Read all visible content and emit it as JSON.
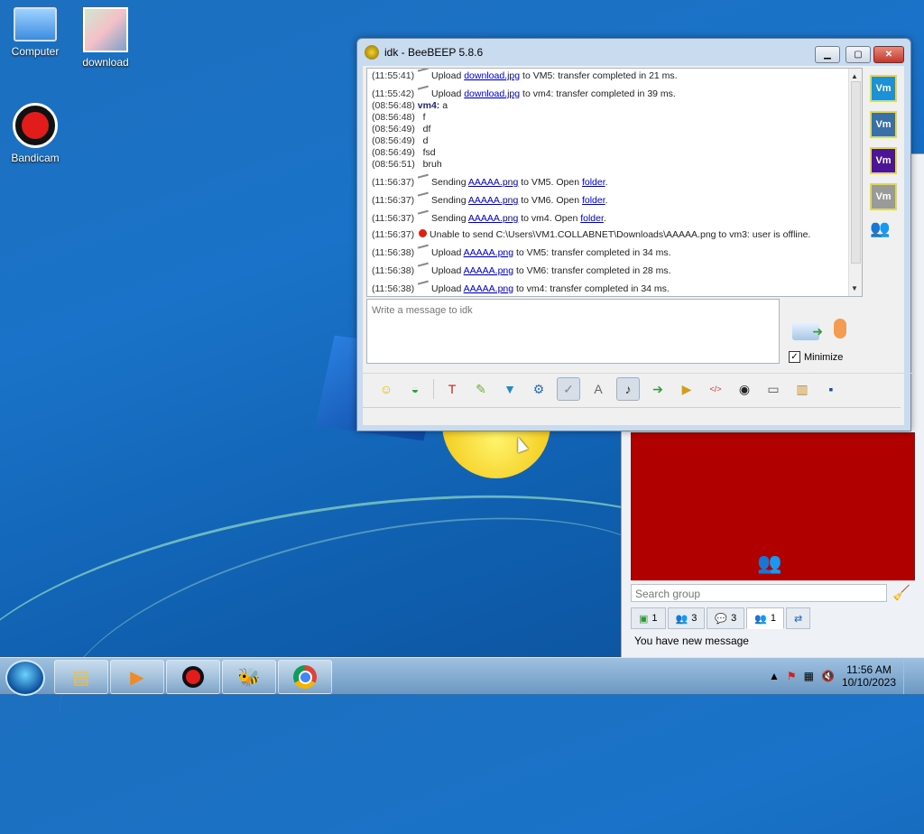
{
  "desktop": {
    "icons": [
      {
        "label": "Computer",
        "icon": "computer-icon"
      },
      {
        "label": "download",
        "icon": "image-file-icon"
      },
      {
        "label": "Bandicam",
        "icon": "bandicam-icon"
      }
    ]
  },
  "chat_window": {
    "title": "idk - BeeBEEP 5.8.6",
    "log": [
      {
        "time": "(11:55:41)",
        "pre": "Upload ",
        "link": "download.jpg",
        "post": " to VM5: transfer completed in 21 ms."
      },
      {
        "time": "(11:55:42)",
        "pre": "Upload ",
        "link": "download.jpg",
        "post": " to vm4: transfer completed in 39 ms."
      },
      {
        "time": "(08:56:48)",
        "who": "vm4:",
        "msg": " a"
      },
      {
        "time": "(08:56:48)",
        "msg": "f"
      },
      {
        "time": "(08:56:49)",
        "msg": "df"
      },
      {
        "time": "(08:56:49)",
        "msg": "d"
      },
      {
        "time": "(08:56:49)",
        "msg": "fsd"
      },
      {
        "time": "(08:56:51)",
        "msg": "bruh"
      },
      {
        "time": "(11:56:37)",
        "pre": "Sending ",
        "link": "AAAAA.png",
        "post": " to VM5. Open ",
        "link2": "folder",
        "post2": "."
      },
      {
        "time": "(11:56:37)",
        "pre": "Sending ",
        "link": "AAAAA.png",
        "post": " to VM6. Open ",
        "link2": "folder",
        "post2": "."
      },
      {
        "time": "(11:56:37)",
        "pre": "Sending ",
        "link": "AAAAA.png",
        "post": " to vm4. Open ",
        "link2": "folder",
        "post2": "."
      },
      {
        "time": "(11:56:37)",
        "error": "Unable to send C:\\Users\\VM1.COLLABNET\\Downloads\\AAAAA.png to vm3: user is offline."
      },
      {
        "time": "(11:56:38)",
        "pre": "Upload ",
        "link": "AAAAA.png",
        "post": " to VM5: transfer completed in 34 ms."
      },
      {
        "time": "(11:56:38)",
        "pre": "Upload ",
        "link": "AAAAA.png",
        "post": " to VM6: transfer completed in 28 ms."
      },
      {
        "time": "(11:56:38)",
        "pre": "Upload ",
        "link": "AAAAA.png",
        "post": " to vm4: transfer completed in 34 ms."
      }
    ],
    "input_placeholder": "Write a message to idk",
    "minimize_label": "Minimize",
    "minimize_checked": "✓",
    "members": [
      {
        "label": "Vm",
        "color": "#1e90d6"
      },
      {
        "label": "Vm",
        "color": "#3a6fa8"
      },
      {
        "label": "Vm",
        "color": "#4b1596"
      },
      {
        "label": "Vm",
        "color": "#9a9a9a"
      }
    ],
    "toolbar_icons": [
      "emoji-icon",
      "nudge-icon",
      "font-icon",
      "color-icon",
      "filter-icon",
      "settings-icon",
      "spellcheck-icon",
      "text-format-icon",
      "note-icon",
      "send-file-icon",
      "send-folder-icon",
      "html-icon",
      "screenshot-icon",
      "save-icon",
      "history-icon",
      "floppy-icon"
    ]
  },
  "main_window": {
    "search_placeholder": "Search group",
    "tabs": [
      {
        "count": "1",
        "icon": "online-users-icon"
      },
      {
        "count": "3",
        "icon": "groups-icon"
      },
      {
        "count": "3",
        "icon": "chats-icon"
      },
      {
        "count": "1",
        "icon": "users-icon"
      },
      {
        "count": "",
        "icon": "share-icon"
      }
    ],
    "status": "You have new message"
  },
  "taskbar": {
    "buttons": [
      "explorer-icon",
      "media-player-icon",
      "bandicam-icon",
      "beebeep-icon",
      "chrome-icon"
    ],
    "time": "11:56 AM",
    "date": "10/10/2023"
  }
}
